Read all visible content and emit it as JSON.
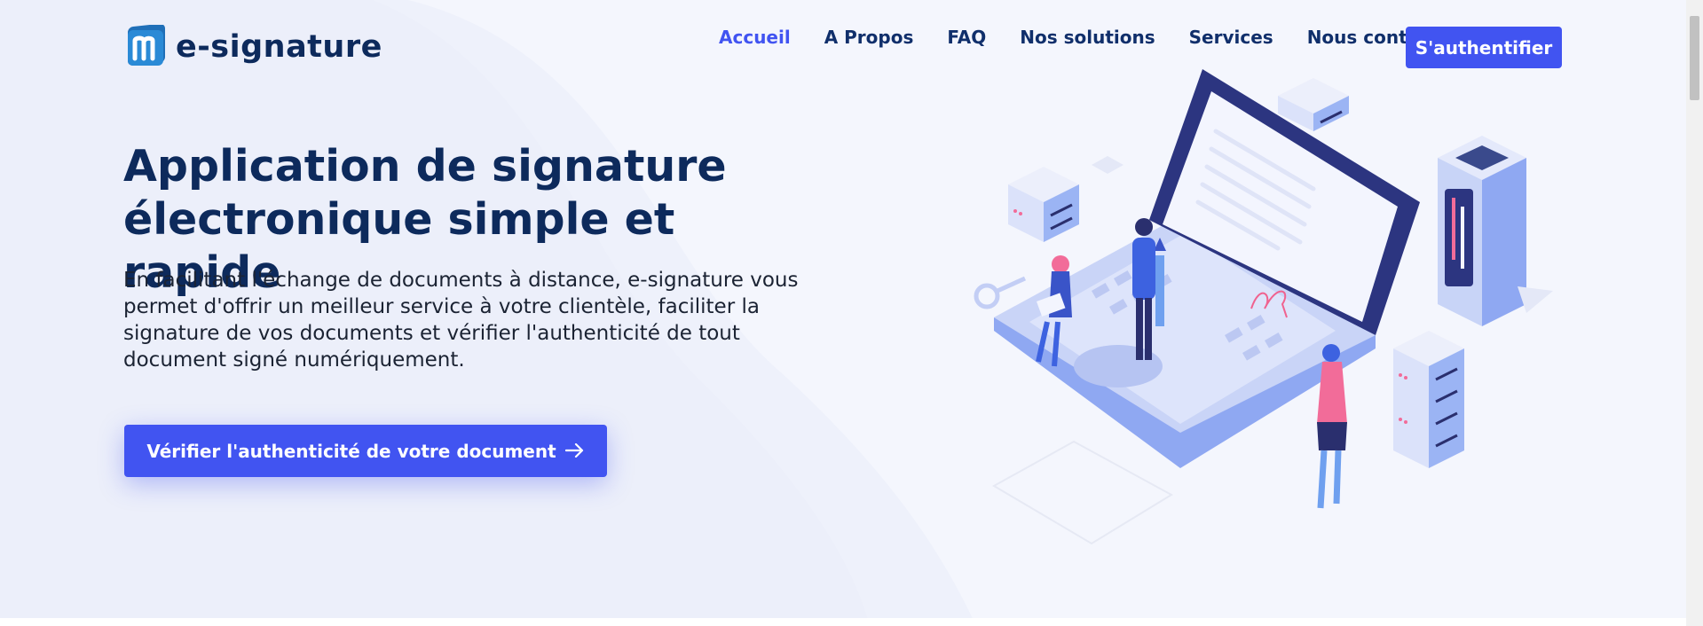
{
  "brand": {
    "name": "e-signature",
    "logo_letter": "m",
    "color_primary": "#4154f1",
    "color_dark": "#0d2a5c"
  },
  "nav": {
    "items": [
      {
        "label": "Accueil",
        "active": true
      },
      {
        "label": "A Propos"
      },
      {
        "label": "FAQ"
      },
      {
        "label": "Nos solutions"
      },
      {
        "label": "Services"
      },
      {
        "label": "Nous contacter"
      }
    ],
    "login_label": "S'authentifier"
  },
  "hero": {
    "title": "Application de signature électronique simple et rapide",
    "description": "En facilitant l'échange de documents à distance, e-signature vous permet d'offrir un meilleur service à votre clientèle, faciliter la signature de vos documents et vérifier l'authenticité de tout document signé numériquement.",
    "cta_label": "Vérifier l'authenticité de votre document",
    "cta_icon": "arrow-right-icon",
    "illustration": "isometric-laptop-signature-illustration"
  }
}
